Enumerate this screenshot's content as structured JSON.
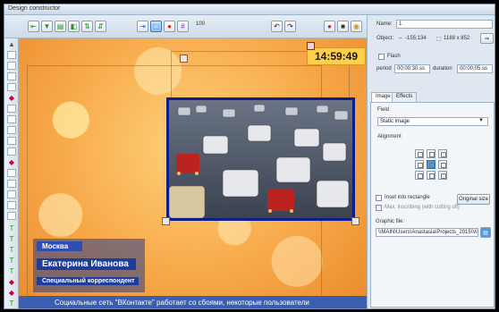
{
  "window": {
    "title": "Design constructor"
  },
  "toolbar": {
    "zoom": "100"
  },
  "canvas": {
    "clock": "14:59:49",
    "lower_third": {
      "line1": "Москва",
      "line2": "Екатерина Иванова",
      "line3": "Специальный корреспондент"
    },
    "ticker": "Социальные сеть \"ВКонтакте\" работает со сбоями, некоторые пользователи"
  },
  "properties": {
    "name_label": "Name:",
    "name_value": "1",
    "object_label": "Object:",
    "position": "-155;134",
    "size": "1188 x 852",
    "flash_label": "Flash",
    "period_label": "period",
    "period_value": "00:00:30.ss",
    "duration_label": "duration",
    "duration_value": "00:00:05.ss",
    "tabs": [
      "Image",
      "Effects"
    ],
    "field_label": "Field",
    "field_value": "Static image",
    "alignment_label": "Alignment",
    "inset_label": "Inset into rectangle",
    "max_label": "Max. inscribing (with cutting off)",
    "original_size_button": "Original size",
    "graphic_file_label": "Graphic file:",
    "graphic_file_path": "\\\\MAIN\\Users\\Anastasia\\Projects_2015\\Vid"
  }
}
